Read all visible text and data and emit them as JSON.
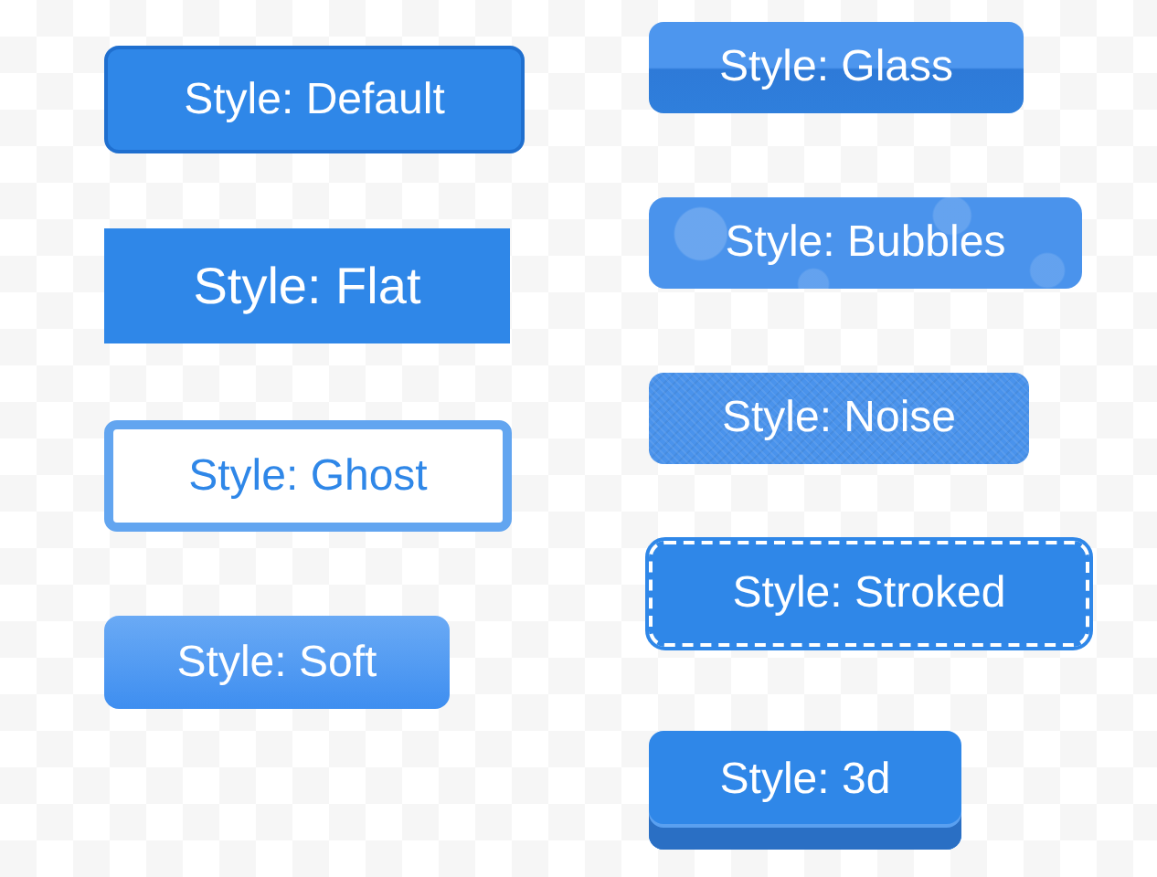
{
  "left_column": [
    {
      "label": "Style: Default",
      "kind": "default"
    },
    {
      "label": "Style: Flat",
      "kind": "flat"
    },
    {
      "label": "Style: Ghost",
      "kind": "ghost"
    },
    {
      "label": "Style: Soft",
      "kind": "soft"
    }
  ],
  "right_column": [
    {
      "label": "Style: Glass",
      "kind": "glass"
    },
    {
      "label": "Style: Bubbles",
      "kind": "bubbles"
    },
    {
      "label": "Style: Noise",
      "kind": "noise"
    },
    {
      "label": "Style: Stroked",
      "kind": "stroked"
    },
    {
      "label": "Style: 3d",
      "kind": "three-d"
    }
  ]
}
